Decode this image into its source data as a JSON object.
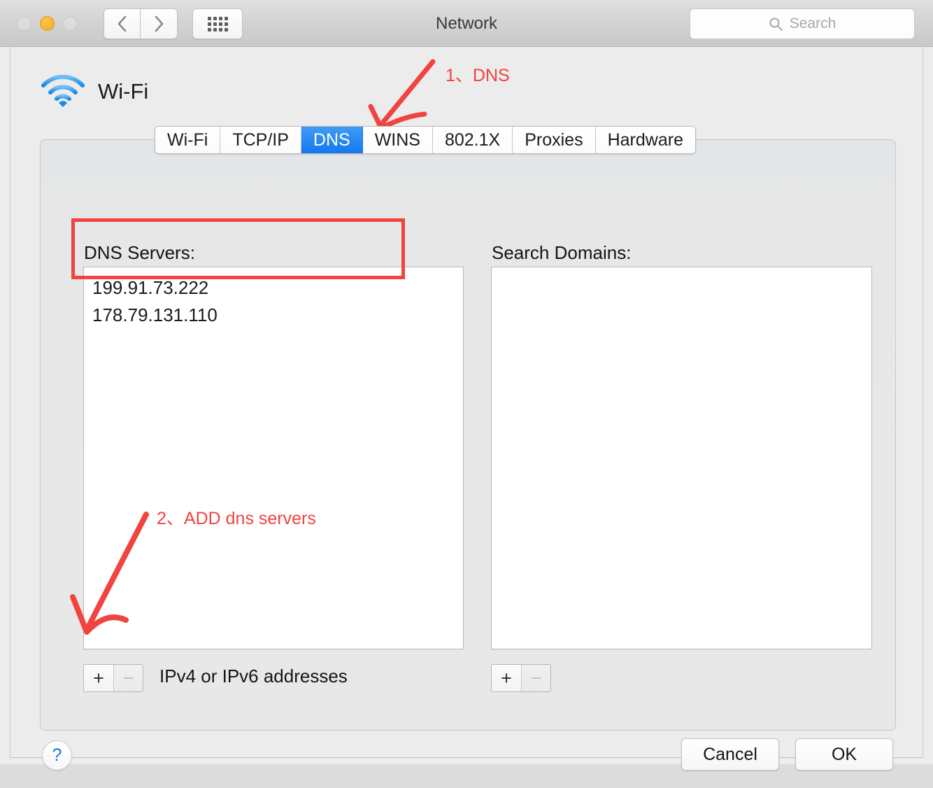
{
  "window": {
    "title": "Network",
    "traffic_lights": [
      {
        "name": "close",
        "state": "inactive",
        "color": "#dcdcdc"
      },
      {
        "name": "minimize",
        "state": "active",
        "color": "#f5a623"
      },
      {
        "name": "maximize",
        "state": "inactive",
        "color": "#dcdcdc"
      }
    ],
    "nav": {
      "back_label": "‹",
      "forward_label": "›"
    },
    "grid_button": "show-all-icon",
    "search": {
      "placeholder": "Search",
      "value": "",
      "icon": "search-icon"
    }
  },
  "service": {
    "name": "Wi-Fi",
    "icon": "wifi-icon"
  },
  "tabs": [
    {
      "label": "Wi-Fi",
      "selected": false
    },
    {
      "label": "TCP/IP",
      "selected": false
    },
    {
      "label": "DNS",
      "selected": true
    },
    {
      "label": "WINS",
      "selected": false
    },
    {
      "label": "802.1X",
      "selected": false
    },
    {
      "label": "Proxies",
      "selected": false
    },
    {
      "label": "Hardware",
      "selected": false
    }
  ],
  "dns_panel": {
    "servers_label": "DNS Servers:",
    "servers": [
      "199.91.73.222",
      "178.79.131.110"
    ],
    "servers_hint": "IPv4 or IPv6 addresses",
    "domains_label": "Search Domains:",
    "domains": [],
    "add_label": "+",
    "remove_label": "−"
  },
  "footer": {
    "help_label": "?",
    "cancel_label": "Cancel",
    "ok_label": "OK"
  },
  "annotations": {
    "color": "#f1433f",
    "note_1": "1、DNS",
    "note_2": "2、ADD dns servers",
    "highlight_target": "dns-server-list"
  }
}
